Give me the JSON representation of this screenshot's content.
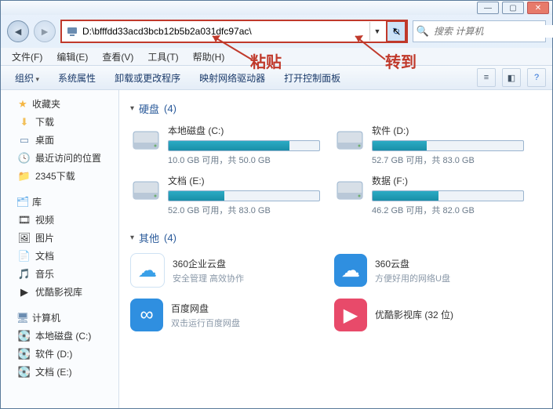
{
  "address_path": "D:\\bfffdd33acd3bcb12b5b2a031dfc97ac\\",
  "search_placeholder": "搜索 计算机",
  "annotations": {
    "paste": "粘贴",
    "goto": "转到"
  },
  "menu": {
    "file": "文件(F)",
    "edit": "编辑(E)",
    "view": "查看(V)",
    "tools": "工具(T)",
    "help": "帮助(H)"
  },
  "toolbar": {
    "organize": "组织",
    "sysprops": "系统属性",
    "uninstall": "卸载或更改程序",
    "mapdrive": "映射网络驱动器",
    "ctrlpanel": "打开控制面板"
  },
  "sidebar": {
    "favorites": {
      "label": "收藏夹",
      "items": [
        "下载",
        "桌面",
        "最近访问的位置",
        "2345下载"
      ]
    },
    "libraries": {
      "label": "库",
      "items": [
        "视频",
        "图片",
        "文档",
        "音乐",
        "优酷影视库"
      ]
    },
    "computer": {
      "label": "计算机",
      "items": [
        "本地磁盘 (C:)",
        "软件 (D:)",
        "文档 (E:)"
      ]
    }
  },
  "sections": {
    "drives_label": "硬盘",
    "drives_count": "(4)",
    "other_label": "其他",
    "other_count": "(4)"
  },
  "drives": [
    {
      "name": "本地磁盘 (C:)",
      "space": "10.0 GB 可用，共 50.0 GB",
      "pct": 80
    },
    {
      "name": "软件 (D:)",
      "space": "52.7 GB 可用，共 83.0 GB",
      "pct": 36
    },
    {
      "name": "文档 (E:)",
      "space": "52.0 GB 可用，共 83.0 GB",
      "pct": 37
    },
    {
      "name": "数据 (F:)",
      "space": "46.2 GB 可用，共 82.0 GB",
      "pct": 44
    }
  ],
  "others": [
    {
      "name": "360企业云盘",
      "desc": "安全管理 高效协作",
      "bg": "#ffffff",
      "fg": "#3aa0e8",
      "glyph": "☁"
    },
    {
      "name": "360云盘",
      "desc": "方便好用的网络U盘",
      "bg": "#2f8fe0",
      "fg": "#ffffff",
      "glyph": "☁"
    },
    {
      "name": "百度网盘",
      "desc": "双击运行百度网盘",
      "bg": "#2f8fe0",
      "fg": "#ffffff",
      "glyph": "∞"
    },
    {
      "name": "优酷影视库 (32 位)",
      "desc": "",
      "bg": "#e84a6a",
      "fg": "#ffffff",
      "glyph": "▶"
    }
  ],
  "chart_data": {
    "type": "bar",
    "title": "Drive usage",
    "series": [
      {
        "name": "本地磁盘 (C:)",
        "free_gb": 10.0,
        "total_gb": 50.0
      },
      {
        "name": "软件 (D:)",
        "free_gb": 52.7,
        "total_gb": 83.0
      },
      {
        "name": "文档 (E:)",
        "free_gb": 52.0,
        "total_gb": 83.0
      },
      {
        "name": "数据 (F:)",
        "free_gb": 46.2,
        "total_gb": 82.0
      }
    ]
  }
}
